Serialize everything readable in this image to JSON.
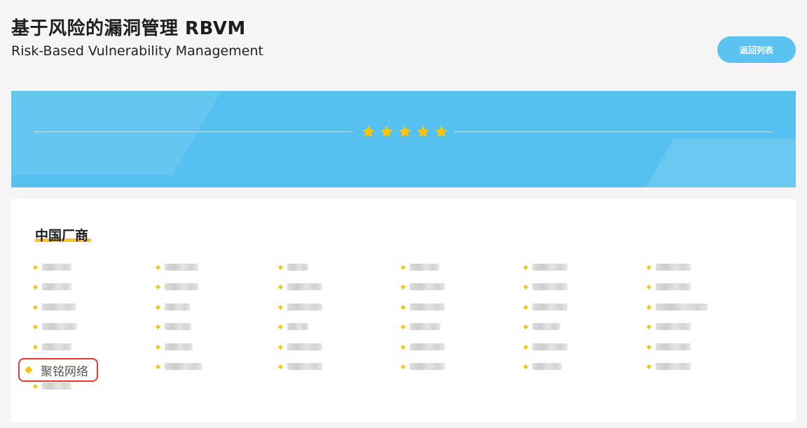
{
  "header": {
    "title": "基于风险的漏洞管理 RBVM",
    "subtitle": "Risk-Based Vulnerability Management",
    "back_button_label": "返回列表"
  },
  "banner": {
    "rating": 5,
    "star_icon": "star-icon",
    "star_color": "#ffc400",
    "background_color": "#56c1f0"
  },
  "section": {
    "title": "中国厂商",
    "underline_color": "#f7c42b",
    "highlighted_vendor": "聚铭网络",
    "highlight_color": "#e53935"
  },
  "colors": {
    "accent": "#5bc3f1",
    "bullet": "#f3c614"
  }
}
